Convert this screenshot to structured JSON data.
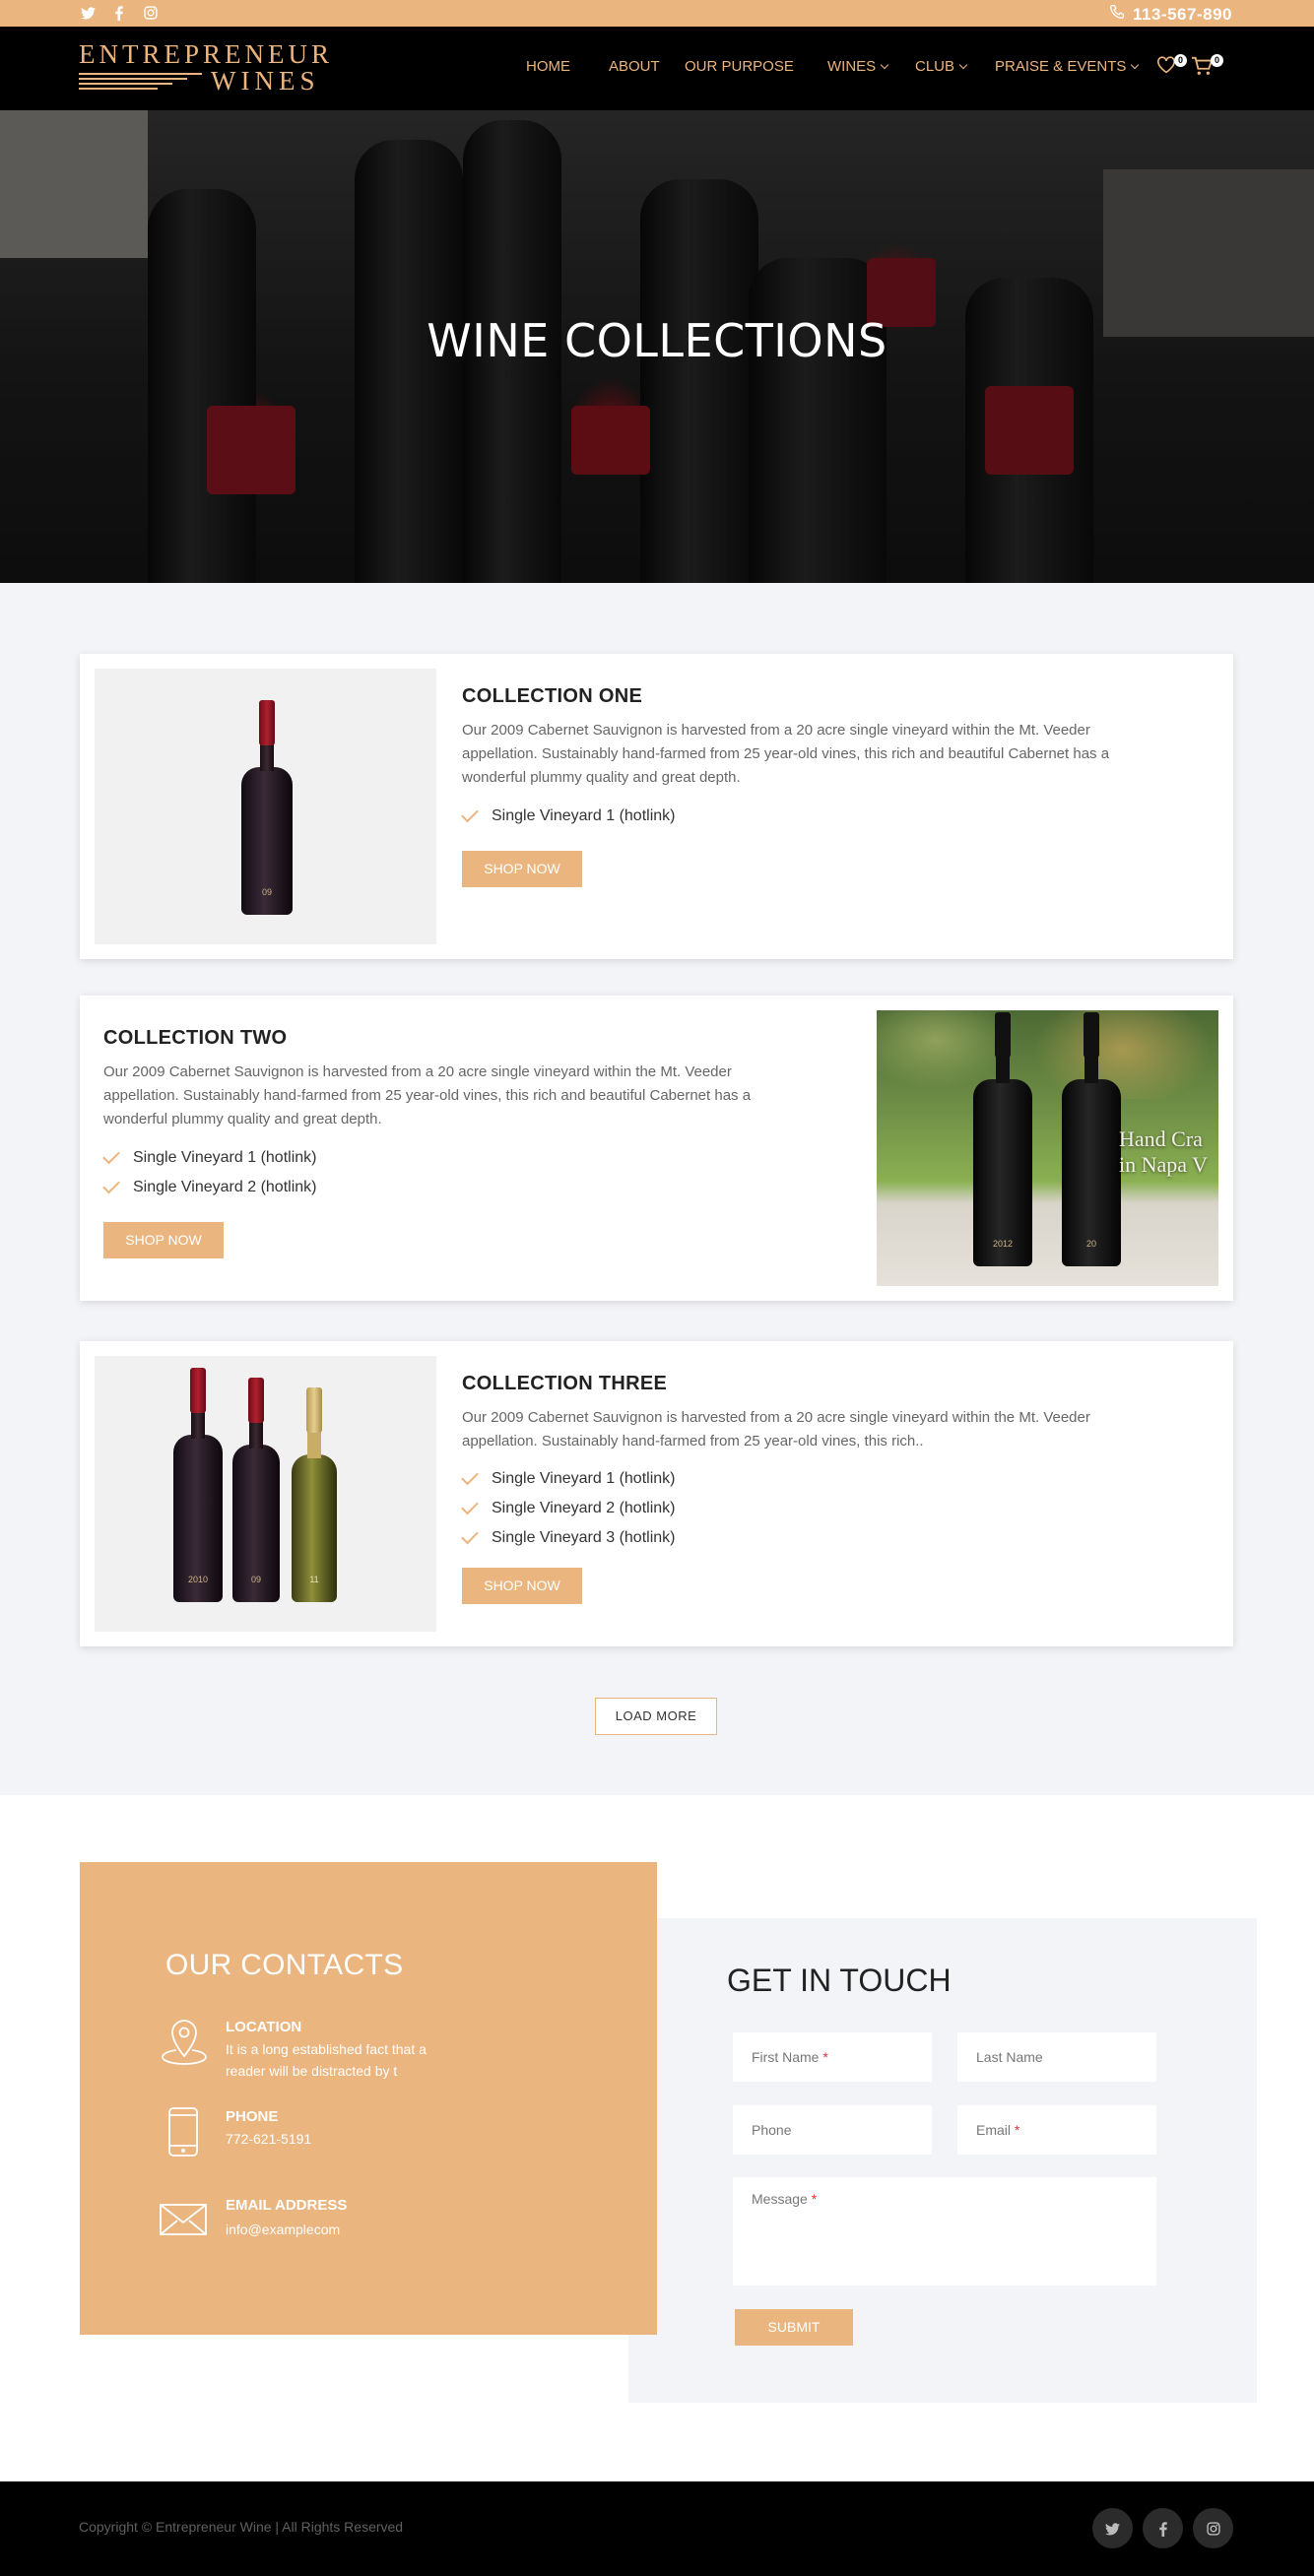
{
  "topbar": {
    "socials": [
      "twitter-icon",
      "facebook-icon",
      "instagram-icon"
    ],
    "phone": "113-567-890"
  },
  "header": {
    "logo_line1": "ENTREPRENEUR",
    "logo_line2": "WINES",
    "nav": [
      {
        "label": "HOME"
      },
      {
        "label": "ABOUT"
      },
      {
        "label": "OUR PURPOSE"
      },
      {
        "label": "WINES"
      },
      {
        "label": "CLUB"
      },
      {
        "label": "PRAISE & EVENTS"
      }
    ],
    "wishlist_count": "0",
    "cart_count": "0"
  },
  "hero": {
    "title": "WINE COLLECTIONS"
  },
  "collections": [
    {
      "title": "COLLECTION ONE",
      "description": "Our 2009 Cabernet Sauvignon is harvested from a 20 acre single vineyard within the Mt. Veeder appellation. Sustainably hand-farmed from 25 year-old vines, this rich and beautiful Cabernet has a wonderful plummy quality and great depth.",
      "items": [
        "Single Vineyard 1 (hotlink)"
      ],
      "button": "SHOP NOW"
    },
    {
      "title": "COLLECTION TWO",
      "description": "Our 2009 Cabernet Sauvignon is harvested from a 20 acre single vineyard within the Mt. Veeder appellation. Sustainably hand-farmed from 25 year-old vines, this rich and beautiful Cabernet has a wonderful plummy quality and great depth.",
      "items": [
        "Single Vineyard 1 (hotlink)",
        "Single Vineyard 2 (hotlink)"
      ],
      "button": "SHOP NOW",
      "image_text_1": "Hand Cra",
      "image_text_2": "in Napa V"
    },
    {
      "title": "COLLECTION THREE",
      "description": "Our 2009 Cabernet Sauvignon is harvested from a 20 acre single vineyard within the Mt. Veeder appellation. Sustainably hand-farmed from 25 year-old vines, this rich..",
      "items": [
        "Single Vineyard 1 (hotlink)",
        "Single Vineyard 2 (hotlink)",
        "Single Vineyard 3 (hotlink)"
      ],
      "button": "SHOP NOW"
    }
  ],
  "load_more": "LOAD MORE",
  "contacts": {
    "title": "OUR CONTACTS",
    "location_title": "LOCATION",
    "location_line1": "It is a long established fact that a",
    "location_line2": "reader will be distracted by t",
    "phone_title": "PHONE",
    "phone_value": "772-621-5191",
    "email_title": "EMAIL ADDRESS",
    "email_value": "info@examplecom"
  },
  "form": {
    "title": "GET IN TOUCH",
    "first_name": "First Name",
    "last_name": "Last Name",
    "phone": "Phone",
    "email": "Email",
    "message": "Message",
    "required_mark": "*",
    "submit": "SUBMIT"
  },
  "footer": {
    "copyright": "Copyright © Entrepreneur Wine | All Rights Reserved",
    "socials": [
      "twitter-icon",
      "facebook-icon",
      "instagram-icon"
    ]
  },
  "colors": {
    "accent": "#ebb57f",
    "header_bg": "#000000",
    "section_bg": "#f3f4f8"
  }
}
